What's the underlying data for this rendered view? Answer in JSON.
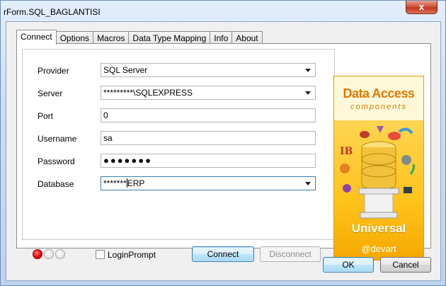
{
  "window": {
    "title": "rForm.SQL_BAGLANTISI",
    "close_glyph": "x"
  },
  "tabs": [
    {
      "label": "Connect",
      "active": true
    },
    {
      "label": "Options"
    },
    {
      "label": "Macros"
    },
    {
      "label": "Data Type Mapping"
    },
    {
      "label": "Info"
    },
    {
      "label": "About"
    }
  ],
  "form": {
    "provider": {
      "label": "Provider",
      "value": "SQL Server"
    },
    "server": {
      "label": "Server",
      "value": "*********\\SQLEXPRESS"
    },
    "port": {
      "label": "Port",
      "value": "0"
    },
    "username": {
      "label": "Username",
      "value": "sa"
    },
    "password": {
      "label": "Password",
      "value": "●●●●●●●"
    },
    "database": {
      "label": "Database",
      "value_prefix": "*******",
      "value_suffix": "ERP"
    }
  },
  "status_leds": [
    "#e00000",
    "#e2e2e2",
    "#e2e2e2"
  ],
  "login_prompt": {
    "label": "LoginPrompt",
    "checked": false
  },
  "buttons": {
    "connect": "Connect",
    "disconnect": "Disconnect",
    "ok": "OK",
    "cancel": "Cancel"
  },
  "banner": {
    "title": "Data Access",
    "subtitle": "components",
    "edition": "Universal",
    "brand": "devart"
  }
}
